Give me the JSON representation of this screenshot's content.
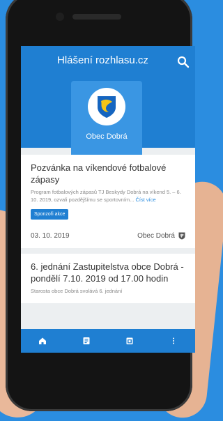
{
  "app": {
    "title": "Hlášení rozhlasu.cz",
    "municipality": "Obec Dobrá"
  },
  "cards": [
    {
      "title": "Pozvánka na víkendové fotbalové zápasy",
      "text": "Program fotbalových zápasů TJ Beskydy Dobrá na víkend 5. – 6. 10. 2019, ozvali pozdějšímu se sportovním...",
      "more": "Číst více",
      "button": "Sponzoři akce",
      "date": "03. 10. 2019",
      "source": "Obec Dobrá"
    },
    {
      "title": "6. jednání Zastupitelstva obce Dobrá - pondělí 7.10. 2019 od 17.00 hodin",
      "text": "Starosta obce Dobrá svolává 6. jednání"
    }
  ],
  "icons": {
    "search": "search-icon",
    "home": "home-icon",
    "list": "list-icon",
    "calendar": "calendar-icon",
    "more": "more-vertical-icon"
  },
  "colors": {
    "primary": "#1f7fd2",
    "background": "#2b8de0",
    "link": "#2b8de0"
  }
}
